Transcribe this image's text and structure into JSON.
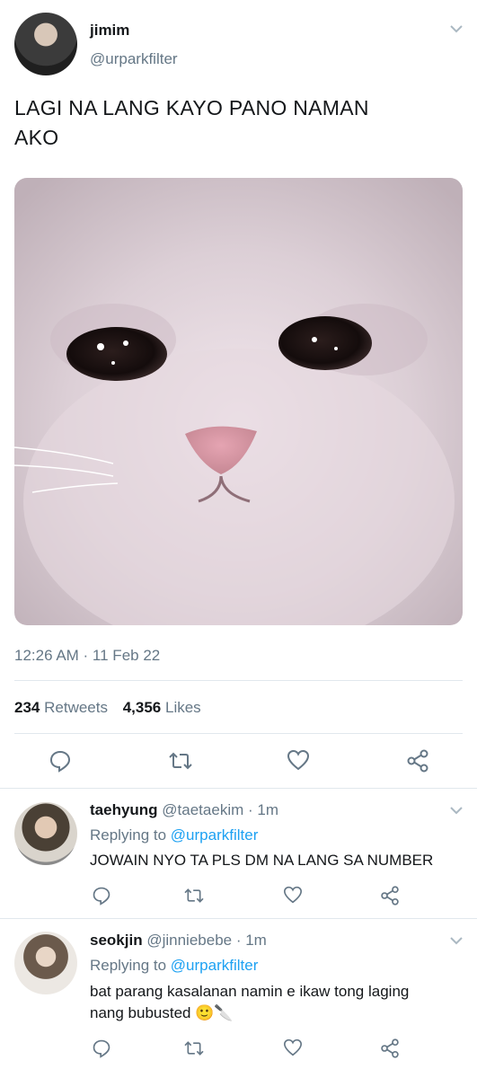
{
  "tweet": {
    "display_name": "jimim",
    "handle": "@urparkfilter",
    "text_line1": "LAGI NA LANG KAYO PANO NAMAN",
    "text_line2": "AKO",
    "timestamp": "12:26 AM · 11 Feb 22",
    "retweets_count": "234",
    "retweets_label": "Retweets",
    "likes_count": "4,356",
    "likes_label": "Likes"
  },
  "replies": [
    {
      "display_name": "taehyung",
      "handle": "@taetaekim",
      "time": "· 1m",
      "replying_prefix": "Replying to",
      "replying_handle": "@urparkfilter",
      "text": "JOWAIN NYO TA PLS DM NA LANG SA NUMBER"
    },
    {
      "display_name": "seokjin",
      "handle": "@jinniebebe",
      "time": "· 1m",
      "replying_prefix": "Replying to",
      "replying_handle": "@urparkfilter",
      "text_line1": "bat parang kasalanan namin e ikaw tong laging",
      "text_line2": "nang bubusted",
      "emoji": "🙂🔪"
    }
  ],
  "icons": {
    "reply": "reply-icon",
    "retweet": "retweet-icon",
    "like": "heart-icon",
    "share": "share-icon",
    "more": "chevron-down-icon"
  },
  "colors": {
    "link": "#1da1f2",
    "secondary": "#657786",
    "divider": "#e1e8ed"
  }
}
